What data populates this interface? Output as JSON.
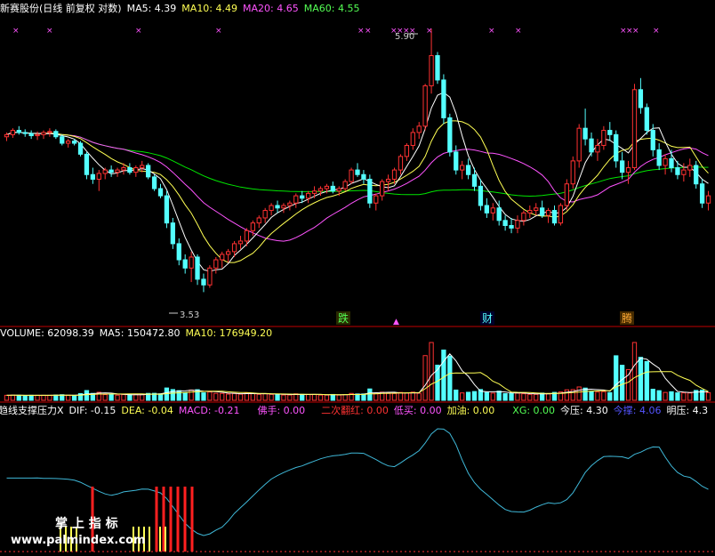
{
  "price_header": {
    "title": "新赛股份(日线 前复权 对数)",
    "ma5": "MA5: 4.39",
    "ma10": "MA10: 4.49",
    "ma20": "MA20: 4.65",
    "ma60": "MA60: 4.55"
  },
  "volume_header": {
    "vol": "VOLUME: 62098.39",
    "ma5": "MA5: 150472.80",
    "ma10": "MA10: 176949.20"
  },
  "indicator_header": {
    "name": "趋线支撑压力X",
    "dif": "DIF: -0.15",
    "dea": "DEA: -0.04",
    "macd": "MACD: -0.21",
    "foshou": "佛手: 0.00",
    "erci": "二次翻红: 0.00",
    "dimai": "低买: 0.00",
    "jiayou": "加油: 0.00",
    "xg": "XG: 0.00",
    "jinya": "今压: 4.30",
    "jincheng": "今撑: 4.06",
    "mingya": "明压: 4.3"
  },
  "annotations": {
    "high_label": "5.90",
    "low_label": "3.53",
    "signal_die": "跌",
    "signal_cai": "财",
    "signal_teng": "腾",
    "watermark_top": "掌 上 指 标",
    "watermark_bottom": "www.palmindex.com"
  },
  "colors": {
    "up": "#ff3232",
    "down": "#54ffff",
    "ma5": "#ffffff",
    "ma10": "#ffff54",
    "ma20": "#ff54ff",
    "ma60": "#00e600",
    "macd_line": "#3fb8d8",
    "marker": "#ff54ff"
  },
  "chart_data": [
    {
      "type": "candlestick",
      "title": "新赛股份(日线 前复权 对数)",
      "ylim": [
        3.4,
        6.05
      ],
      "series": [
        {
          "name": "MA5",
          "value": 4.39
        },
        {
          "name": "MA10",
          "value": 4.49
        },
        {
          "name": "MA20",
          "value": 4.65
        },
        {
          "name": "MA60",
          "value": 4.55
        }
      ],
      "annotations": [
        {
          "label": "5.90",
          "type": "high"
        },
        {
          "label": "3.53",
          "type": "low"
        }
      ],
      "candles": [
        [
          4.78,
          4.82,
          4.74,
          4.8
        ],
        [
          4.8,
          4.86,
          4.77,
          4.84
        ],
        [
          4.84,
          4.88,
          4.8,
          4.82
        ],
        [
          4.82,
          4.85,
          4.78,
          4.81
        ],
        [
          4.81,
          4.84,
          4.76,
          4.79
        ],
        [
          4.79,
          4.83,
          4.75,
          4.8
        ],
        [
          4.8,
          4.84,
          4.76,
          4.82
        ],
        [
          4.82,
          4.86,
          4.78,
          4.83
        ],
        [
          4.83,
          4.85,
          4.76,
          4.78
        ],
        [
          4.78,
          4.8,
          4.7,
          4.72
        ],
        [
          4.72,
          4.76,
          4.68,
          4.74
        ],
        [
          4.74,
          4.76,
          4.7,
          4.72
        ],
        [
          4.72,
          4.74,
          4.6,
          4.62
        ],
        [
          4.62,
          4.64,
          4.4,
          4.44
        ],
        [
          4.44,
          4.5,
          4.36,
          4.4
        ],
        [
          4.4,
          4.48,
          4.3,
          4.45
        ],
        [
          4.45,
          4.5,
          4.4,
          4.48
        ],
        [
          4.48,
          4.52,
          4.42,
          4.46
        ],
        [
          4.46,
          4.5,
          4.42,
          4.48
        ],
        [
          4.48,
          4.54,
          4.44,
          4.5
        ],
        [
          4.5,
          4.54,
          4.44,
          4.46
        ],
        [
          4.46,
          4.52,
          4.42,
          4.5
        ],
        [
          4.5,
          4.56,
          4.46,
          4.52
        ],
        [
          4.52,
          4.54,
          4.4,
          4.42
        ],
        [
          4.42,
          4.44,
          4.3,
          4.32
        ],
        [
          4.32,
          4.36,
          4.24,
          4.26
        ],
        [
          4.26,
          4.3,
          4.0,
          4.04
        ],
        [
          4.04,
          4.08,
          3.84,
          3.88
        ],
        [
          3.88,
          3.92,
          3.72,
          3.76
        ],
        [
          3.76,
          3.8,
          3.66,
          3.7
        ],
        [
          3.7,
          3.82,
          3.6,
          3.78
        ],
        [
          3.78,
          3.8,
          3.58,
          3.62
        ],
        [
          3.62,
          3.66,
          3.53,
          3.58
        ],
        [
          3.58,
          3.72,
          3.56,
          3.7
        ],
        [
          3.7,
          3.78,
          3.66,
          3.76
        ],
        [
          3.76,
          3.82,
          3.7,
          3.8
        ],
        [
          3.8,
          3.84,
          3.74,
          3.82
        ],
        [
          3.82,
          3.9,
          3.78,
          3.88
        ],
        [
          3.88,
          3.94,
          3.84,
          3.9
        ],
        [
          3.9,
          4.0,
          3.86,
          3.98
        ],
        [
          3.98,
          4.06,
          3.94,
          4.04
        ],
        [
          4.04,
          4.1,
          4.0,
          4.08
        ],
        [
          4.08,
          4.16,
          4.04,
          4.14
        ],
        [
          4.14,
          4.2,
          4.1,
          4.18
        ],
        [
          4.18,
          4.22,
          4.12,
          4.16
        ],
        [
          4.16,
          4.2,
          4.12,
          4.18
        ],
        [
          4.18,
          4.22,
          4.14,
          4.2
        ],
        [
          4.2,
          4.28,
          4.16,
          4.26
        ],
        [
          4.26,
          4.3,
          4.2,
          4.24
        ],
        [
          4.24,
          4.3,
          4.2,
          4.28
        ],
        [
          4.28,
          4.34,
          4.24,
          4.3
        ],
        [
          4.3,
          4.34,
          4.26,
          4.32
        ],
        [
          4.32,
          4.36,
          4.28,
          4.34
        ],
        [
          4.34,
          4.38,
          4.28,
          4.3
        ],
        [
          4.3,
          4.34,
          4.26,
          4.32
        ],
        [
          4.32,
          4.4,
          4.3,
          4.38
        ],
        [
          4.38,
          4.5,
          4.36,
          4.48
        ],
        [
          4.48,
          4.54,
          4.42,
          4.44
        ],
        [
          4.44,
          4.48,
          4.36,
          4.4
        ],
        [
          4.4,
          4.44,
          4.16,
          4.2
        ],
        [
          4.2,
          4.28,
          4.14,
          4.26
        ],
        [
          4.26,
          4.4,
          4.22,
          4.38
        ],
        [
          4.38,
          4.44,
          4.3,
          4.4
        ],
        [
          4.4,
          4.5,
          4.36,
          4.48
        ],
        [
          4.48,
          4.62,
          4.44,
          4.6
        ],
        [
          4.6,
          4.72,
          4.56,
          4.7
        ],
        [
          4.7,
          4.86,
          4.66,
          4.82
        ],
        [
          4.82,
          4.92,
          4.76,
          4.88
        ],
        [
          4.88,
          5.3,
          4.84,
          5.28
        ],
        [
          5.28,
          5.9,
          5.2,
          5.6
        ],
        [
          5.6,
          5.64,
          5.3,
          5.34
        ],
        [
          5.34,
          5.4,
          4.9,
          4.96
        ],
        [
          4.96,
          5.0,
          4.6,
          4.64
        ],
        [
          4.64,
          4.7,
          4.44,
          4.48
        ],
        [
          4.48,
          4.56,
          4.4,
          4.52
        ],
        [
          4.52,
          4.58,
          4.4,
          4.44
        ],
        [
          4.44,
          4.5,
          4.3,
          4.34
        ],
        [
          4.34,
          4.4,
          4.14,
          4.18
        ],
        [
          4.18,
          4.24,
          4.08,
          4.12
        ],
        [
          4.12,
          4.2,
          4.06,
          4.16
        ],
        [
          4.16,
          4.22,
          4.02,
          4.06
        ],
        [
          4.06,
          4.1,
          3.98,
          4.02
        ],
        [
          4.02,
          4.08,
          3.96,
          4.0
        ],
        [
          4.0,
          4.1,
          3.96,
          4.06
        ],
        [
          4.06,
          4.14,
          4.02,
          4.12
        ],
        [
          4.12,
          4.18,
          4.08,
          4.14
        ],
        [
          4.14,
          4.2,
          4.1,
          4.16
        ],
        [
          4.16,
          4.22,
          4.08,
          4.1
        ],
        [
          4.1,
          4.16,
          4.04,
          4.14
        ],
        [
          4.14,
          4.18,
          4.02,
          4.04
        ],
        [
          4.04,
          4.2,
          4.02,
          4.18
        ],
        [
          4.18,
          4.4,
          4.14,
          4.36
        ],
        [
          4.36,
          4.6,
          4.32,
          4.56
        ],
        [
          4.56,
          4.9,
          4.5,
          4.86
        ],
        [
          4.86,
          5.05,
          4.7,
          4.76
        ],
        [
          4.76,
          4.82,
          4.6,
          4.64
        ],
        [
          4.64,
          4.76,
          4.56,
          4.7
        ],
        [
          4.7,
          4.88,
          4.66,
          4.84
        ],
        [
          4.84,
          4.92,
          4.74,
          4.8
        ],
        [
          4.8,
          4.84,
          4.5,
          4.56
        ],
        [
          4.56,
          4.64,
          4.4,
          4.46
        ],
        [
          4.46,
          4.56,
          4.36,
          4.5
        ],
        [
          4.5,
          5.3,
          4.48,
          5.24
        ],
        [
          5.24,
          5.36,
          5.0,
          5.06
        ],
        [
          5.06,
          5.1,
          4.8,
          4.84
        ],
        [
          4.84,
          4.9,
          4.6,
          4.66
        ],
        [
          4.66,
          4.72,
          4.48,
          4.52
        ],
        [
          4.52,
          4.62,
          4.44,
          4.58
        ],
        [
          4.58,
          4.66,
          4.46,
          4.5
        ],
        [
          4.5,
          4.56,
          4.4,
          4.44
        ],
        [
          4.44,
          4.54,
          4.38,
          4.48
        ],
        [
          4.48,
          4.58,
          4.42,
          4.52
        ],
        [
          4.52,
          4.56,
          4.32,
          4.36
        ],
        [
          4.36,
          4.4,
          4.16,
          4.2
        ],
        [
          4.2,
          4.3,
          4.14,
          4.26
        ]
      ]
    },
    {
      "type": "bar",
      "title": "VOLUME",
      "series": [
        {
          "name": "VOLUME",
          "value": 62098.39
        },
        {
          "name": "MA5",
          "value": 150472.8
        },
        {
          "name": "MA10",
          "value": 176949.2
        }
      ],
      "ylim": [
        0,
        900000
      ]
    },
    {
      "type": "line",
      "title": "趋线支撑压力X",
      "series": [
        {
          "name": "DIF",
          "value": -0.15
        },
        {
          "name": "DEA",
          "value": -0.04
        },
        {
          "name": "MACD",
          "value": -0.21
        },
        {
          "name": "佛手",
          "value": 0.0
        },
        {
          "name": "二次翻红",
          "value": 0.0
        },
        {
          "name": "低买",
          "value": 0.0
        },
        {
          "name": "加油",
          "value": 0.0
        },
        {
          "name": "XG",
          "value": 0.0
        },
        {
          "name": "今压",
          "value": 4.3
        },
        {
          "name": "今撑",
          "value": 4.06
        },
        {
          "name": "明压",
          "value": 4.3
        }
      ]
    }
  ]
}
